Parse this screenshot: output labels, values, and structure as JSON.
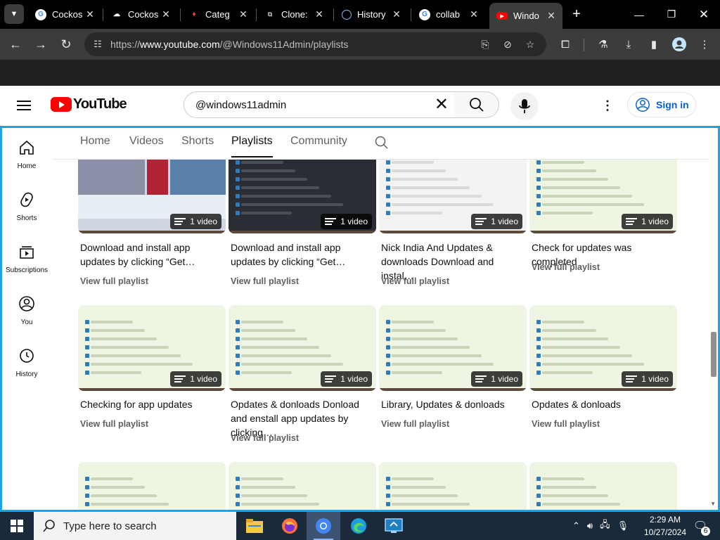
{
  "browser": {
    "tabs": [
      {
        "title": "Cockos",
        "icon": "google-icon",
        "active": false
      },
      {
        "title": "Cockos",
        "icon": "cockos-icon",
        "active": false
      },
      {
        "title": "Categ",
        "icon": "flame-icon",
        "active": false
      },
      {
        "title": "Clone:",
        "icon": "clone-icon",
        "active": false
      },
      {
        "title": "History",
        "icon": "history-icon",
        "active": false
      },
      {
        "title": "collab",
        "icon": "google-icon",
        "active": false
      },
      {
        "title": "Windo",
        "icon": "youtube-icon",
        "active": true
      }
    ],
    "url_prefix": "https://",
    "url_host": "www.youtube.com",
    "url_path": "/@Windows11Admin/playlists"
  },
  "youtube": {
    "logo_text": "YouTube",
    "search_value": "@windows11admin",
    "signin_label": "Sign in",
    "sidebar": [
      {
        "label": "Home",
        "icon": "home-icon"
      },
      {
        "label": "Shorts",
        "icon": "shorts-icon"
      },
      {
        "label": "Subscriptions",
        "icon": "subscriptions-icon"
      },
      {
        "label": "You",
        "icon": "you-icon"
      },
      {
        "label": "History",
        "icon": "history-icon"
      }
    ],
    "channel_tabs": [
      {
        "label": "Home",
        "active": false
      },
      {
        "label": "Videos",
        "active": false
      },
      {
        "label": "Shorts",
        "active": false
      },
      {
        "label": "Playlists",
        "active": true
      },
      {
        "label": "Community",
        "active": false
      }
    ],
    "view_label": "View full playlist",
    "playlists": [
      {
        "title": "Download and install app updates by clicking “Get…",
        "count": "1 video",
        "thumb": "photo"
      },
      {
        "title": "Download and install app updates by clicking “Get…",
        "count": "1 video",
        "thumb": "dark"
      },
      {
        "title": "Nick India And Updates & downloads Download and instal…",
        "count": "1 video",
        "thumb": "white"
      },
      {
        "title": "Check for updates was completed",
        "count": "1 video",
        "thumb": "green"
      },
      {
        "title": "Checking for app updates",
        "count": "1 video",
        "thumb": "green"
      },
      {
        "title": "Opdates & donloads Donload and enstall app updates by clicking…",
        "count": "1 video",
        "thumb": "green"
      },
      {
        "title": "Library, Updates & donloads",
        "count": "1 video",
        "thumb": "green"
      },
      {
        "title": "Opdates & donloads",
        "count": "1 video",
        "thumb": "green"
      },
      {
        "title": "",
        "count": "",
        "thumb": "green"
      },
      {
        "title": "",
        "count": "",
        "thumb": "green"
      },
      {
        "title": "",
        "count": "",
        "thumb": "green"
      },
      {
        "title": "",
        "count": "",
        "thumb": "green"
      }
    ]
  },
  "taskbar": {
    "search_placeholder": "Type here to search",
    "time": "2:29 AM",
    "date": "10/27/2024",
    "notification_count": "6",
    "apps": [
      "file-explorer-icon",
      "firefox-icon",
      "chrome-icon",
      "edge-icon",
      "remote-desktop-icon"
    ]
  }
}
